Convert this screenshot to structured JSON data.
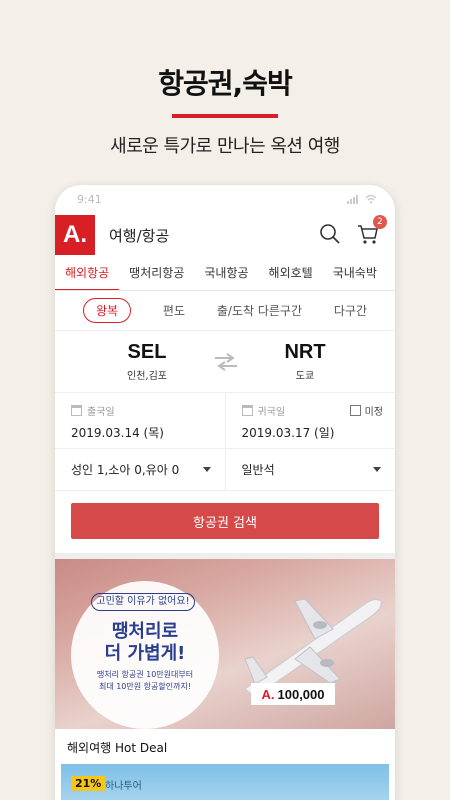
{
  "promo": {
    "title": "항공권,숙박",
    "subtitle": "새로운 특가로 만나는 옥션 여행"
  },
  "status_bar": {
    "time": "9:41"
  },
  "app_bar": {
    "logo": "A.",
    "title": "여행/항공",
    "cart_count": "2"
  },
  "tabs": [
    {
      "label": "해외항공",
      "active": true
    },
    {
      "label": "땡처리항공",
      "active": false
    },
    {
      "label": "국내항공",
      "active": false
    },
    {
      "label": "해외호텔",
      "active": false
    },
    {
      "label": "국내숙박",
      "active": false
    }
  ],
  "trip_types": [
    {
      "label": "왕복",
      "active": true
    },
    {
      "label": "편도",
      "active": false
    },
    {
      "label": "출/도착 다른구간",
      "active": false
    },
    {
      "label": "다구간",
      "active": false
    }
  ],
  "route": {
    "origin_code": "SEL",
    "origin_city": "인천,김포",
    "dest_code": "NRT",
    "dest_city": "도쿄"
  },
  "dates": {
    "depart_label": "출국일",
    "depart_value": "2019.03.14 (목)",
    "return_label": "귀국일",
    "return_value": "2019.03.17 (일)",
    "undecided_label": "미정"
  },
  "passengers": "성인 1,소아 0,유아 0",
  "seat_class": "일반석",
  "search_button": "항공권 검색",
  "banner": {
    "tag": "고민할 이유가 없어요!",
    "headline1": "땡처리로",
    "headline2": "더 가볍게!",
    "small1": "땡처리 항공권 10만원대부터",
    "small2": "최대 10만원 항공할인까지!",
    "price_logo": "A.",
    "price": "100,000"
  },
  "hot_deal": {
    "title": "해외여행 Hot Deal",
    "discount": "21%",
    "vendor": "하나투어"
  },
  "colors": {
    "brand_red": "#d81f26",
    "search_button": "#d54a48",
    "banner_navy": "#2a3d8f"
  }
}
